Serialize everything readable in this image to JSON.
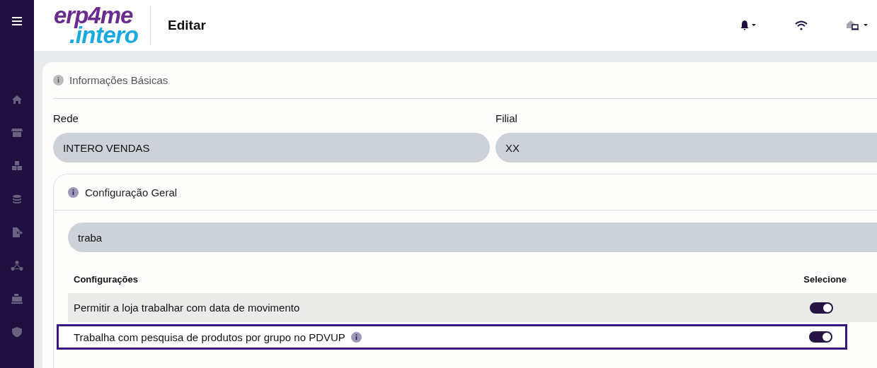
{
  "header": {
    "logo_top": "erp4me",
    "logo_bottom": ".intero",
    "title": "Editar"
  },
  "sidebar": {
    "items": [
      {
        "kind": "home"
      },
      {
        "kind": "store"
      },
      {
        "kind": "boxes"
      },
      {
        "kind": "coins"
      },
      {
        "kind": "export"
      },
      {
        "kind": "network"
      },
      {
        "kind": "register"
      },
      {
        "kind": "shield"
      }
    ]
  },
  "basic_info": {
    "title": "Informações Básicas",
    "fields": [
      {
        "label": "Rede",
        "value": "INTERO VENDAS"
      },
      {
        "label": "Filial",
        "value": "XX"
      }
    ]
  },
  "general_config": {
    "title": "Configuração Geral",
    "search": {
      "value": "traba"
    },
    "columns": [
      "Configurações",
      "Selecione"
    ],
    "rows": [
      {
        "label": "Permitir a loja trabalhar com data de movimento",
        "on": true,
        "highlighted": false,
        "info": false
      },
      {
        "label": "Trabalha com pesquisa de produtos por grupo no PDVUP",
        "on": true,
        "highlighted": true,
        "info": true
      }
    ]
  }
}
